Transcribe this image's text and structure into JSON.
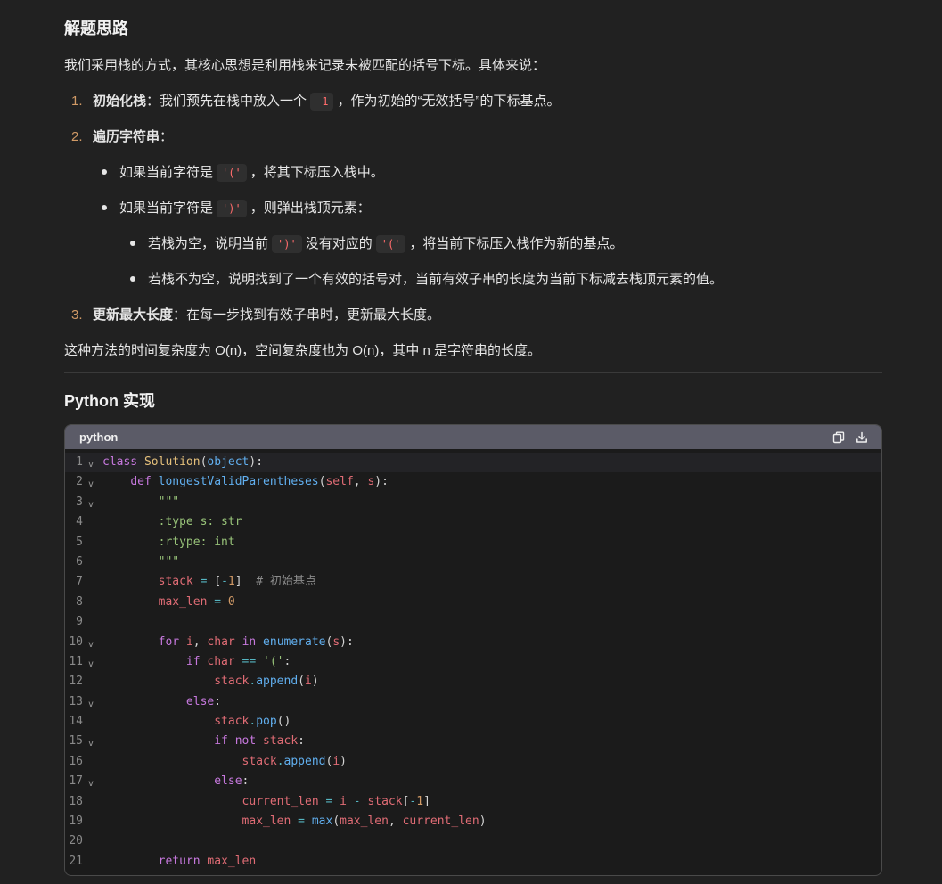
{
  "section1": {
    "title": "解题思路",
    "intro": "我们采用栈的方式，其核心思想是利用栈来记录未被匹配的括号下标。具体来说：",
    "steps": [
      {
        "num": "1.",
        "bold": "初始化栈",
        "rest_a": "：我们预先在栈中放入一个",
        "code": "-1",
        "rest_b": "，作为初始的“无效括号”的下标基点。"
      },
      {
        "num": "2.",
        "bold": "遍历字符串",
        "rest_a": "："
      },
      {
        "num": "3.",
        "bold": "更新最大长度",
        "rest_a": "：在每一步找到有效子串时，更新最大长度。"
      }
    ],
    "bullets": [
      {
        "a": "如果当前字符是",
        "code": "'('",
        "b": "，将其下标压入栈中。"
      },
      {
        "a": "如果当前字符是",
        "code": "')'",
        "b": "，则弹出栈顶元素："
      }
    ],
    "subbullets": [
      {
        "a": "若栈为空，说明当前",
        "code": "')'",
        "b": "没有对应的",
        "code2": "'('",
        "c": "，将当前下标压入栈作为新的基点。"
      },
      {
        "a": "若栈不为空，说明找到了一个有效的括号对，当前有效子串的长度为当前下标减去栈顶元素的值。"
      }
    ],
    "complexity": "这种方法的时间复杂度为 O(n)，空间复杂度也为 O(n)，其中 n 是字符串的长度。"
  },
  "section2": {
    "title": "Python 实现"
  },
  "codeblock": {
    "language": "python",
    "copy_icon": "copy-icon",
    "download_icon": "download-icon",
    "lines": [
      {
        "n": "1",
        "fold": true,
        "text": "class Solution(object):"
      },
      {
        "n": "2",
        "fold": true,
        "text": "    def longestValidParentheses(self, s):"
      },
      {
        "n": "3",
        "fold": true,
        "text": "        \"\"\""
      },
      {
        "n": "4",
        "fold": false,
        "text": "        :type s: str"
      },
      {
        "n": "5",
        "fold": false,
        "text": "        :rtype: int"
      },
      {
        "n": "6",
        "fold": false,
        "text": "        \"\"\""
      },
      {
        "n": "7",
        "fold": false,
        "text": "        stack = [-1]  # 初始基点"
      },
      {
        "n": "8",
        "fold": false,
        "text": "        max_len = 0"
      },
      {
        "n": "9",
        "fold": false,
        "text": ""
      },
      {
        "n": "10",
        "fold": true,
        "text": "        for i, char in enumerate(s):"
      },
      {
        "n": "11",
        "fold": true,
        "text": "            if char == '(':"
      },
      {
        "n": "12",
        "fold": false,
        "text": "                stack.append(i)"
      },
      {
        "n": "13",
        "fold": true,
        "text": "            else:"
      },
      {
        "n": "14",
        "fold": false,
        "text": "                stack.pop()"
      },
      {
        "n": "15",
        "fold": true,
        "text": "                if not stack:"
      },
      {
        "n": "16",
        "fold": false,
        "text": "                    stack.append(i)"
      },
      {
        "n": "17",
        "fold": true,
        "text": "                else:"
      },
      {
        "n": "18",
        "fold": false,
        "text": "                    current_len = i - stack[-1]"
      },
      {
        "n": "19",
        "fold": false,
        "text": "                    max_len = max(max_len, current_len)"
      },
      {
        "n": "20",
        "fold": false,
        "text": ""
      },
      {
        "n": "21",
        "fold": false,
        "text": "        return max_len"
      }
    ]
  }
}
